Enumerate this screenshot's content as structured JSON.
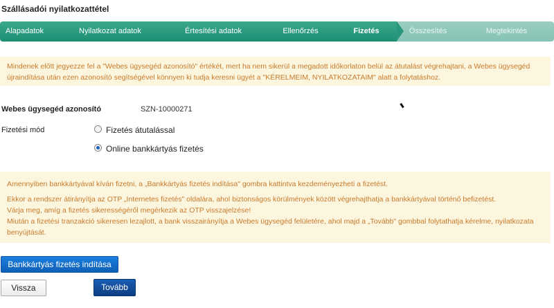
{
  "page": {
    "title": "Szállásadói nyilatkozattétel"
  },
  "steps": [
    {
      "label": "Alapadatok",
      "state": "done"
    },
    {
      "label": "Nyilatkozat adatok",
      "state": "done"
    },
    {
      "label": "Értesítési adatok",
      "state": "done"
    },
    {
      "label": "Ellenőrzés",
      "state": "done"
    },
    {
      "label": "Fizetés",
      "state": "active"
    },
    {
      "label": "Összesítés",
      "state": "todo"
    },
    {
      "label": "Megtekintés",
      "state": "todo"
    }
  ],
  "notice_top": "Mindenek előtt jegyezze fel a \"Webes ügysegéd azonosító\" értékét, mert ha nem sikerül a megadott időkorlaton belül az átutalást végrehajtani, a Webes ügysegéd újraindítása után ezen azonosító segítségével könnyen ki tudja keresni ügyét a \"KÉRELMEIM, NYILATKOZATAIM\" alatt a folytatáshoz.",
  "form": {
    "id_label": "Webes ügysegéd azonosító",
    "id_value": "SZN-10000271",
    "payment_label": "Fizetési mód",
    "options": [
      {
        "label": "Fizetés átutalással",
        "checked": false
      },
      {
        "label": "Online bankkártyás fizetés",
        "checked": true
      }
    ]
  },
  "notice_bottom": {
    "line1": "Amennyiben bankkártyával kíván fizetni, a „Bankkártyás fizetés indítása\" gombra kattintva kezdeményezheti a fizetést.",
    "line2": "Ekkor a rendszer átirányítja az OTP „Internetes fizetés\" oldalára, ahol biztonságos körülmények között végrehajthatja a bankkártyával történő befizetést.",
    "line3": "Várja meg, amíg a fizetés sikerességéről megérkezik az OTP visszajelzése!",
    "line4": "Miután a fizetési tranzakció sikeresen lezajlott, a bank visszairányítja a Webes ügysegéd felületére, ahol majd a „Tovább\" gombbal folytathatja kérelme, nyilatkozata benyújtását."
  },
  "buttons": {
    "start_card_payment": "Bankkártyás fizetés indítása",
    "back": "Vissza",
    "next": "Tovább"
  },
  "colors": {
    "step_done": "#1c8f73",
    "step_todo": "#86c2b3",
    "notice_bg": "#fdf6de",
    "notice_text": "#c87a2c",
    "primary_button": "#0f5fb6"
  }
}
